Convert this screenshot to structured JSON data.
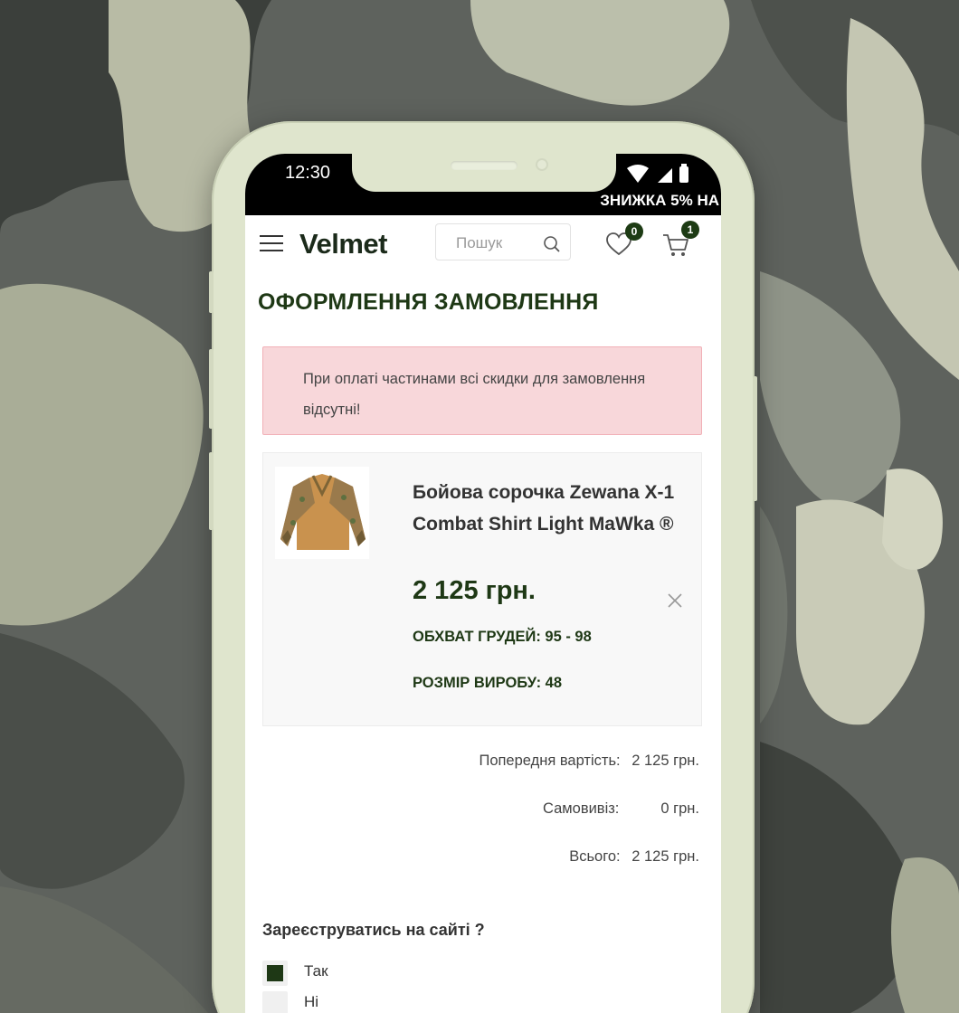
{
  "status_bar": {
    "time": "12:30"
  },
  "promo_banner": "ЗНИЖКА 5% НА",
  "header": {
    "logo": "Velmet",
    "search_placeholder": "Пошук",
    "wishlist_count": "0",
    "cart_count": "1"
  },
  "page_title": "ОФОРМЛЕННЯ ЗАМОВЛЕННЯ",
  "alert": "При оплаті частинами всі скидки для замовлення відсутні!",
  "product": {
    "name": "Бойова сорочка Zewana X-1 Combat Shirt Light MaWka ®",
    "price": "2 125 грн.",
    "attr_chest": "ОБХВАТ ГРУДЕЙ: 95 - 98",
    "attr_size": "РОЗМІР ВИРОБУ: 48",
    "image_icon": "tactical-shirt-image"
  },
  "summary": {
    "subtotal_label": "Попередня вартість:",
    "subtotal_value": "2 125 грн.",
    "pickup_label": "Самовивіз:",
    "pickup_value": "0 грн.",
    "total_label": "Всього:",
    "total_value": "2 125 грн."
  },
  "register": {
    "title": "Зареєструватись на сайті ?",
    "options": [
      {
        "label": "Так",
        "checked": true
      },
      {
        "label": "Ні",
        "checked": false
      }
    ]
  },
  "colors": {
    "brand_green": "#1e3815",
    "alert_bg": "#f8d7da",
    "phone_frame": "#dfe5cd"
  }
}
